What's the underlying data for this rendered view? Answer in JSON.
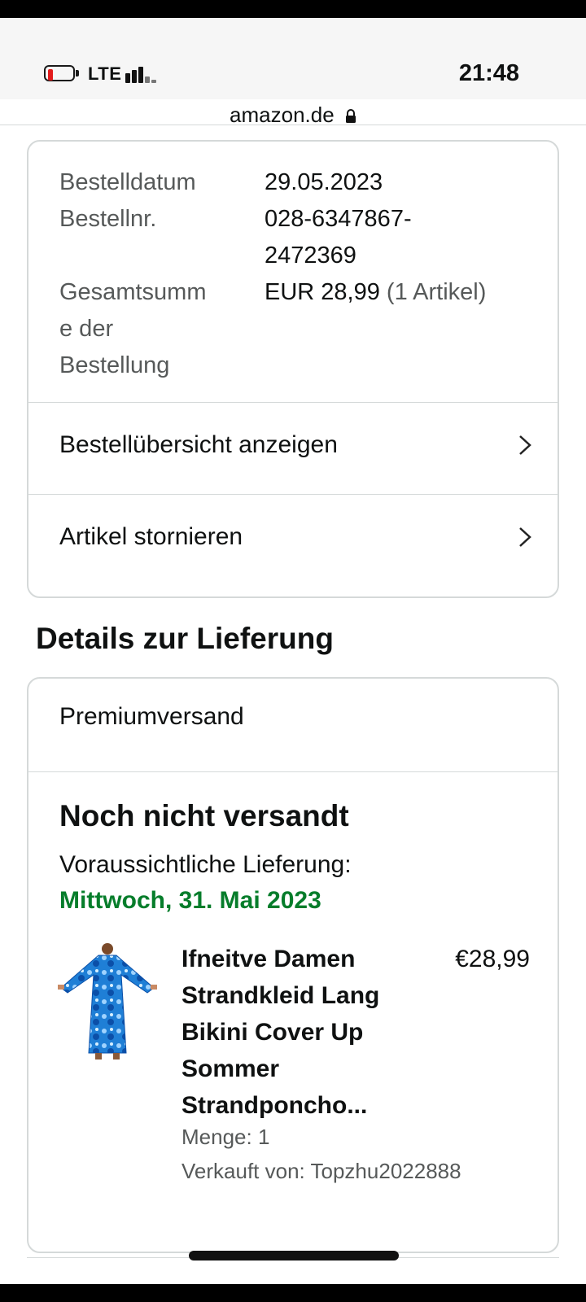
{
  "status_bar": {
    "network": "LTE",
    "time": "21:48",
    "url": "amazon.de"
  },
  "order_info": {
    "rows": [
      {
        "label": "Bestelldatum",
        "value": "29.05.2023"
      },
      {
        "label": "Bestellnr.",
        "value_line1": "028-6347867-",
        "value_line2": "2472369"
      },
      {
        "label_line1": "Gesamtsumm",
        "label_line2": "e der",
        "label_line3": "Bestellung",
        "value": "EUR 28,99",
        "value_note": "(1 Artikel)"
      }
    ],
    "links": [
      {
        "label": "Bestellübersicht anzeigen"
      },
      {
        "label": "Artikel stornieren"
      }
    ]
  },
  "delivery": {
    "heading": "Details zur Lieferung",
    "shipping_method": "Premiumversand",
    "status": "Noch nicht versandt",
    "eta_label": "Voraussichtliche Lieferung:",
    "eta_date": "Mittwoch, 31. Mai 2023",
    "eta_color": "#067d2b",
    "product": {
      "title_lines": [
        "Ifneitve Damen",
        "Strandkleid Lang",
        "Bikini Cover Up",
        "Sommer",
        "Strandponcho..."
      ],
      "price": "€28,99",
      "quantity": "Menge: 1",
      "seller": "Verkauft von: Topzhu2022888",
      "image_icon": "blue-dress-product-image"
    }
  },
  "icons": {
    "battery": "battery-low-icon",
    "signal": "signal-strength-icon",
    "lock": "lock-icon",
    "chevron": "chevron-right-icon"
  }
}
